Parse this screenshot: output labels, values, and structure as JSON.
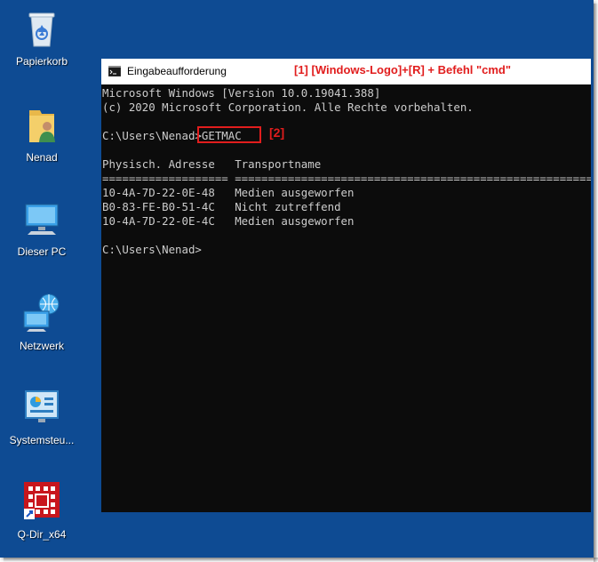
{
  "desktop": {
    "icons": [
      {
        "label": "Papierkorb",
        "icon": "recycle-bin-icon"
      },
      {
        "label": "Nenad",
        "icon": "user-folder-icon"
      },
      {
        "label": "Dieser PC",
        "icon": "computer-icon"
      },
      {
        "label": "Netzwerk",
        "icon": "network-icon"
      },
      {
        "label": "Systemsteu...",
        "icon": "control-panel-icon"
      },
      {
        "label": "Q-Dir_x64",
        "icon": "qdir-shortcut-icon"
      }
    ]
  },
  "window": {
    "title": "Eingabeaufforderung",
    "annotation": "[1] [Windows-Logo]+[R] + Befehl \"cmd\"",
    "highlight_annotation": "[2]"
  },
  "console": {
    "lines": [
      "Microsoft Windows [Version 10.0.19041.388]",
      "(c) 2020 Microsoft Corporation. Alle Rechte vorbehalten.",
      "",
      "C:\\Users\\Nenad>GETMAC",
      "",
      "Physisch. Adresse   Transportname",
      "=================== ==========================================================",
      "10-4A-7D-22-0E-48   Medien ausgeworfen",
      "B0-83-FE-B0-51-4C   Nicht zutreffend",
      "10-4A-7D-22-0E-4C   Medien ausgeworfen",
      "",
      "C:\\Users\\Nenad>"
    ]
  },
  "colors": {
    "desktop_bg": "#0e4b93",
    "console_bg": "#0c0c0c",
    "console_text": "#cccccc",
    "annotation": "#e11d1d"
  }
}
